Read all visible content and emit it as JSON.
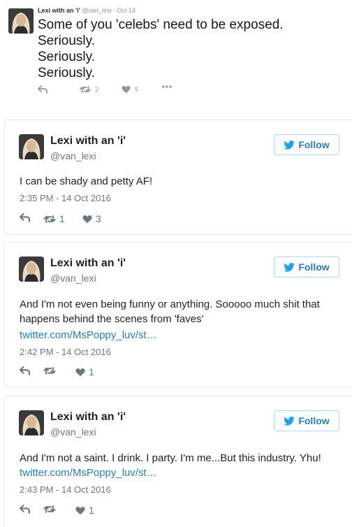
{
  "top_tweet": {
    "name": "Lexi with an 'i'",
    "handle": "@van_lexi",
    "date": "· Oct 14",
    "lines": [
      "Some of you 'celebs' need to be exposed.",
      "Seriously.",
      "Seriously.",
      "Seriously."
    ],
    "retweets": "2",
    "likes": "5"
  },
  "follow_label": "Follow",
  "cards": [
    {
      "name": "Lexi with an 'i'",
      "handle": "@van_lexi",
      "text": "I can be shady and petty AF!",
      "link": "",
      "timestamp": "2:35 PM - 14 Oct 2016",
      "retweets": "1",
      "likes": "3"
    },
    {
      "name": "Lexi with an 'i'",
      "handle": "@van_lexi",
      "text": "And I'm not even being funny or anything. Sooooo much shit that happens behind the scenes from 'faves'",
      "link": "twitter.com/MsPoppy_luv/st…",
      "timestamp": "2:42 PM - 14 Oct 2016",
      "retweets": "",
      "likes": "1"
    },
    {
      "name": "Lexi with an 'i'",
      "handle": "@van_lexi",
      "text": "And I'm not a saint. I drink. I party. I'm me...But this industry. Yhu!",
      "link": "twitter.com/MsPoppy_luv/st…",
      "timestamp": "2:43 PM - 14 Oct 2016",
      "retweets": "",
      "likes": "1"
    }
  ],
  "icons": [
    "reply-icon",
    "retweet-icon",
    "heart-icon",
    "more-icon",
    "twitter-bird-icon",
    "avatar"
  ],
  "colors": {
    "link": "#2b7bb9",
    "muted": "#697882",
    "border": "#e1e8ed",
    "text": "#1c2022"
  }
}
